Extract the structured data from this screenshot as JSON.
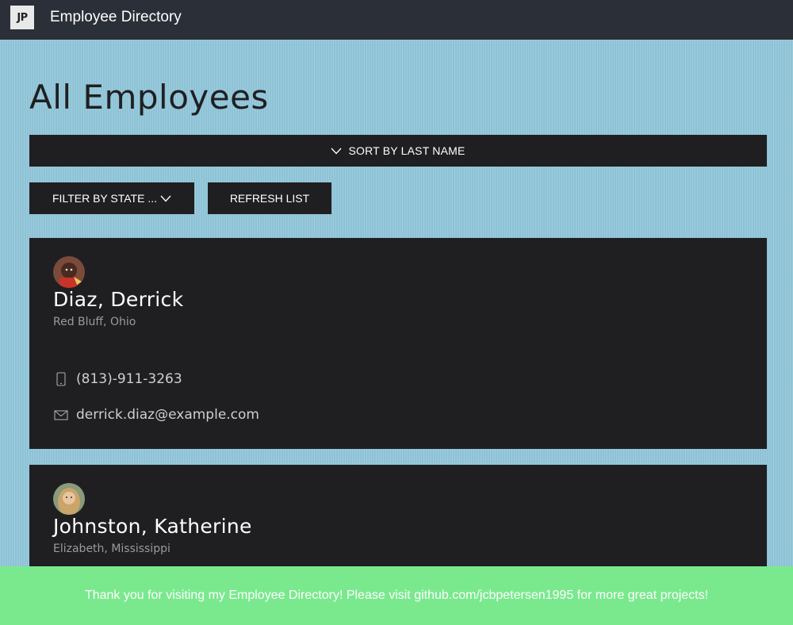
{
  "header": {
    "logo_text": "JP",
    "app_title": "Employee Directory"
  },
  "main": {
    "page_title": "All Employees",
    "sort_label": "SORT BY LAST NAME",
    "filter_label": "FILTER BY STATE ...",
    "refresh_label": "REFRESH LIST"
  },
  "employees": [
    {
      "name": "Diaz, Derrick",
      "location": "Red Bluff, Ohio",
      "phone": "(813)-911-3263",
      "email": "derrick.diaz@example.com"
    },
    {
      "name": "Johnston, Katherine",
      "location": "Elizabeth, Mississippi"
    }
  ],
  "footer": {
    "message": "Thank you for visiting my Employee Directory! Please visit github.com/jcbpetersen1995 for more great projects!"
  },
  "colors": {
    "background": "#93c8db",
    "topbar": "#2b2f38",
    "card": "#1f1f22",
    "footer": "#7ae98e"
  },
  "icons": {
    "phone": "phone-icon",
    "email": "mail-icon",
    "chevron": "chevron-down-icon"
  }
}
